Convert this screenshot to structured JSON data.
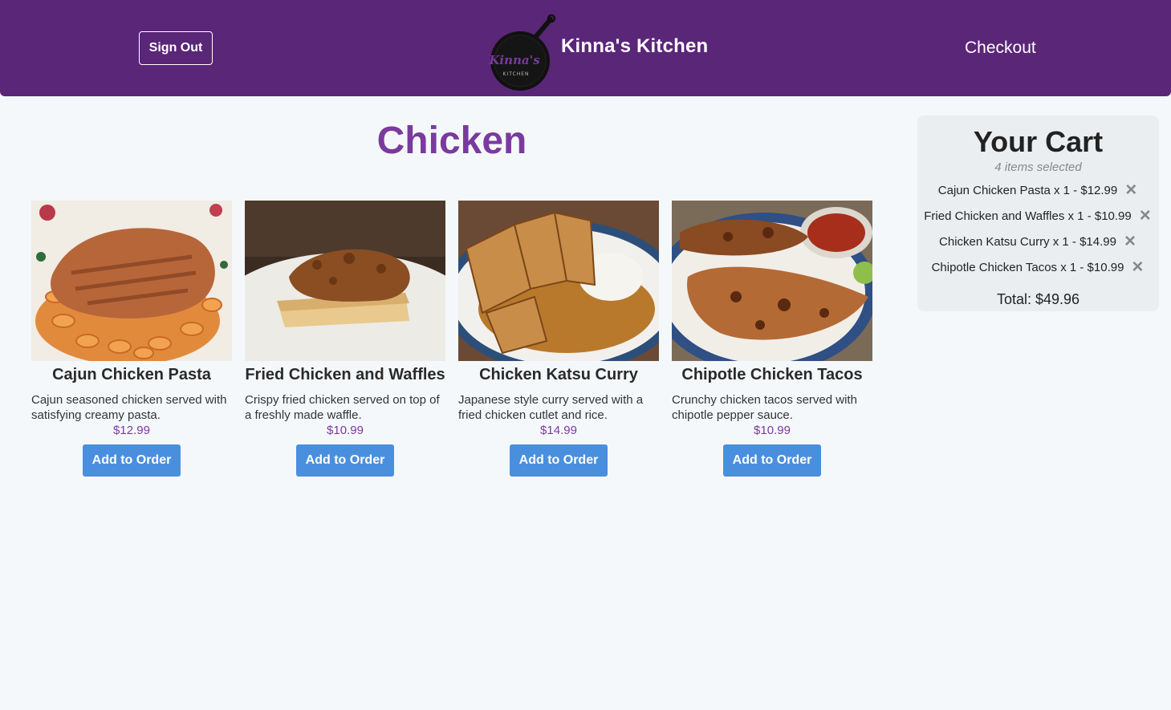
{
  "header": {
    "sign_out_label": "Sign Out",
    "brand": "Kinna's Kitchen",
    "logo_text": "Kinna's",
    "logo_subtext": "KITCHEN",
    "checkout_label": "Checkout"
  },
  "category": {
    "title": "Chicken"
  },
  "menu": {
    "items": [
      {
        "name": "Cajun Chicken Pasta",
        "description": "Cajun seasoned chicken served with satisfying creamy pasta.",
        "price": "$12.99",
        "button": "Add to Order"
      },
      {
        "name": "Fried Chicken and Waffles",
        "description": "Crispy fried chicken served on top of a freshly made waffle.",
        "price": "$10.99",
        "button": "Add to Order"
      },
      {
        "name": "Chicken Katsu Curry",
        "description": "Japanese style curry served with a fried chicken cutlet and rice.",
        "price": "$14.99",
        "button": "Add to Order"
      },
      {
        "name": "Chipotle Chicken Tacos",
        "description": "Crunchy chicken tacos served with chipotle pepper sauce.",
        "price": "$10.99",
        "button": "Add to Order"
      }
    ]
  },
  "cart": {
    "title": "Your Cart",
    "count": "4 items selected",
    "items": [
      {
        "text": "Cajun Chicken Pasta x 1 - $12.99"
      },
      {
        "text": "Fried Chicken and Waffles x 1 - $10.99"
      },
      {
        "text": "Chicken Katsu Curry x 1 - $14.99"
      },
      {
        "text": "Chipotle Chicken Tacos x 1 - $10.99"
      }
    ],
    "remove_icon": "close-icon",
    "total": "Total: $49.96"
  },
  "colors": {
    "header_bg": "#5a2678",
    "accent_purple": "#7a3a9e",
    "button_blue": "#4a8fde",
    "page_bg": "#f5f8fb",
    "cart_bg": "#ebeef1"
  }
}
